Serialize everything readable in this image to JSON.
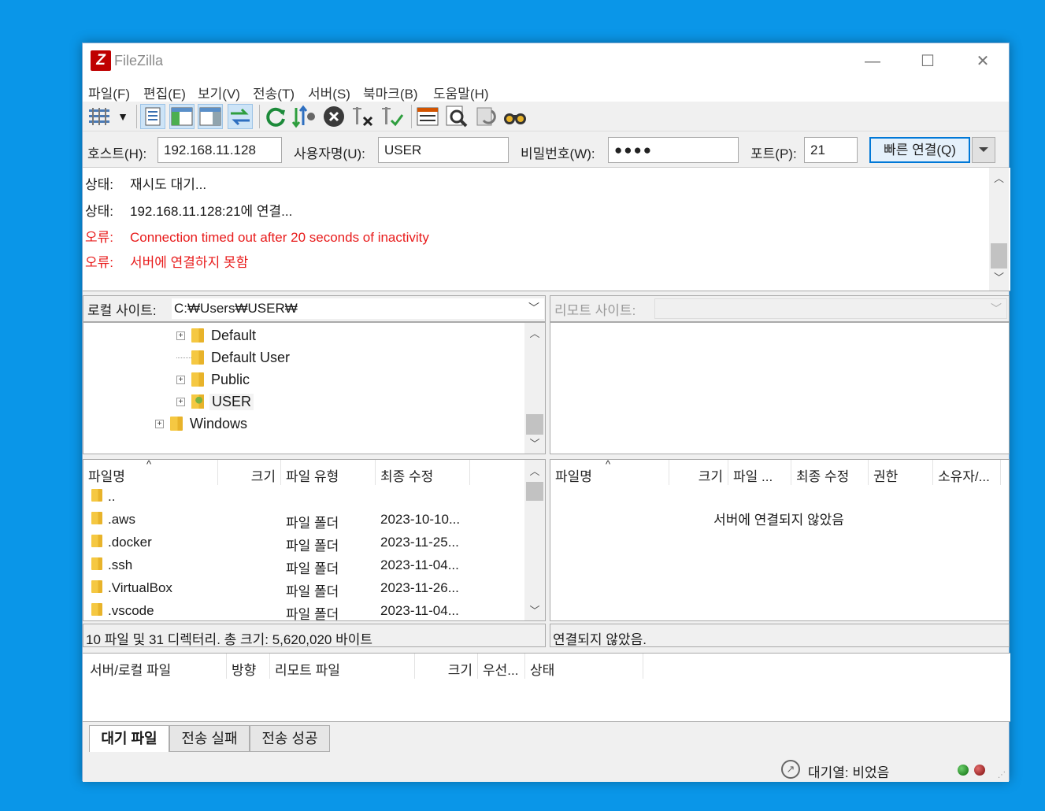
{
  "app": {
    "title": "FileZilla"
  },
  "menu": [
    "파일(F)",
    "편집(E)",
    "보기(V)",
    "전송(T)",
    "서버(S)",
    "북마크(B)",
    "도움말(H)"
  ],
  "quickconnect": {
    "host_label": "호스트(H):",
    "host": "192.168.11.128",
    "user_label": "사용자명(U):",
    "user": "USER",
    "pass_label": "비밀번호(W):",
    "pass": "●●●●",
    "port_label": "포트(P):",
    "port": "21",
    "connect": "빠른 연결(Q)"
  },
  "log": [
    {
      "label": "상태:",
      "text": "재시도 대기..."
    },
    {
      "label": "상태:",
      "text": "192.168.11.128:21에 연결..."
    },
    {
      "label": "오류:",
      "text": "Connection timed out after 20 seconds of inactivity"
    },
    {
      "label": "오류:",
      "text": "서버에 연결하지 못함"
    }
  ],
  "local": {
    "site_label": "로컬 사이트:",
    "path": "C:₩Users₩USER₩",
    "tree": [
      "Default",
      "Default User",
      "Public",
      "USER",
      "Windows"
    ],
    "headers": [
      "파일명",
      "크기",
      "파일 유형",
      "최종 수정"
    ],
    "files": [
      {
        "name": "..",
        "type": "",
        "modified": ""
      },
      {
        "name": ".aws",
        "type": "파일 폴더",
        "modified": "2023-10-10..."
      },
      {
        "name": ".docker",
        "type": "파일 폴더",
        "modified": "2023-11-25..."
      },
      {
        "name": ".ssh",
        "type": "파일 폴더",
        "modified": "2023-11-04..."
      },
      {
        "name": ".VirtualBox",
        "type": "파일 폴더",
        "modified": "2023-11-26..."
      },
      {
        "name": ".vscode",
        "type": "파일 폴더",
        "modified": "2023-11-04..."
      }
    ],
    "status": "10 파일 및 31 디렉터리. 총 크기: 5,620,020 바이트"
  },
  "remote": {
    "site_label": "리모트 사이트:",
    "headers": [
      "파일명",
      "크기",
      "파일 ...",
      "최종 수정",
      "권한",
      "소유자/..."
    ],
    "empty_message": "서버에 연결되지 않았음",
    "status": "연결되지 않았음."
  },
  "queue": {
    "headers": [
      "서버/로컬 파일",
      "방향",
      "리모트 파일",
      "크기",
      "우선...",
      "상태"
    ]
  },
  "tabs": [
    "대기 파일",
    "전송 실패",
    "전송 성공"
  ],
  "statusbar": {
    "queue": "대기열: 비었음"
  },
  "colors": {
    "error": "#e81b1b",
    "desktop": "#0a96e8",
    "accent": "#0078d7"
  }
}
